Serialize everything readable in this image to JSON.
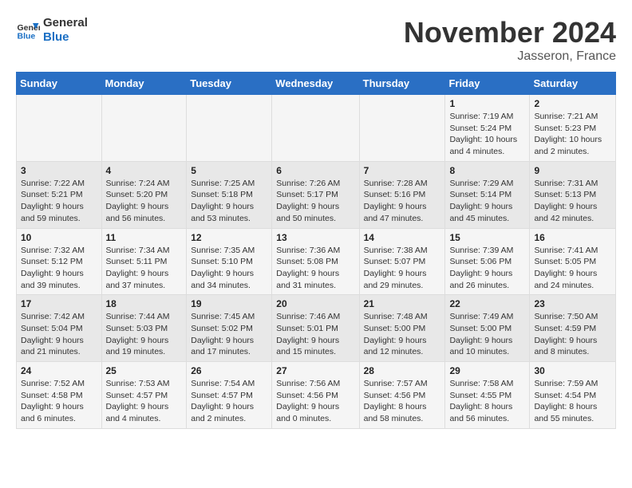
{
  "header": {
    "logo_line1": "General",
    "logo_line2": "Blue",
    "month": "November 2024",
    "location": "Jasseron, France"
  },
  "days_of_week": [
    "Sunday",
    "Monday",
    "Tuesday",
    "Wednesday",
    "Thursday",
    "Friday",
    "Saturday"
  ],
  "weeks": [
    [
      {
        "day": "",
        "info": ""
      },
      {
        "day": "",
        "info": ""
      },
      {
        "day": "",
        "info": ""
      },
      {
        "day": "",
        "info": ""
      },
      {
        "day": "",
        "info": ""
      },
      {
        "day": "1",
        "info": "Sunrise: 7:19 AM\nSunset: 5:24 PM\nDaylight: 10 hours and 4 minutes."
      },
      {
        "day": "2",
        "info": "Sunrise: 7:21 AM\nSunset: 5:23 PM\nDaylight: 10 hours and 2 minutes."
      }
    ],
    [
      {
        "day": "3",
        "info": "Sunrise: 7:22 AM\nSunset: 5:21 PM\nDaylight: 9 hours and 59 minutes."
      },
      {
        "day": "4",
        "info": "Sunrise: 7:24 AM\nSunset: 5:20 PM\nDaylight: 9 hours and 56 minutes."
      },
      {
        "day": "5",
        "info": "Sunrise: 7:25 AM\nSunset: 5:18 PM\nDaylight: 9 hours and 53 minutes."
      },
      {
        "day": "6",
        "info": "Sunrise: 7:26 AM\nSunset: 5:17 PM\nDaylight: 9 hours and 50 minutes."
      },
      {
        "day": "7",
        "info": "Sunrise: 7:28 AM\nSunset: 5:16 PM\nDaylight: 9 hours and 47 minutes."
      },
      {
        "day": "8",
        "info": "Sunrise: 7:29 AM\nSunset: 5:14 PM\nDaylight: 9 hours and 45 minutes."
      },
      {
        "day": "9",
        "info": "Sunrise: 7:31 AM\nSunset: 5:13 PM\nDaylight: 9 hours and 42 minutes."
      }
    ],
    [
      {
        "day": "10",
        "info": "Sunrise: 7:32 AM\nSunset: 5:12 PM\nDaylight: 9 hours and 39 minutes."
      },
      {
        "day": "11",
        "info": "Sunrise: 7:34 AM\nSunset: 5:11 PM\nDaylight: 9 hours and 37 minutes."
      },
      {
        "day": "12",
        "info": "Sunrise: 7:35 AM\nSunset: 5:10 PM\nDaylight: 9 hours and 34 minutes."
      },
      {
        "day": "13",
        "info": "Sunrise: 7:36 AM\nSunset: 5:08 PM\nDaylight: 9 hours and 31 minutes."
      },
      {
        "day": "14",
        "info": "Sunrise: 7:38 AM\nSunset: 5:07 PM\nDaylight: 9 hours and 29 minutes."
      },
      {
        "day": "15",
        "info": "Sunrise: 7:39 AM\nSunset: 5:06 PM\nDaylight: 9 hours and 26 minutes."
      },
      {
        "day": "16",
        "info": "Sunrise: 7:41 AM\nSunset: 5:05 PM\nDaylight: 9 hours and 24 minutes."
      }
    ],
    [
      {
        "day": "17",
        "info": "Sunrise: 7:42 AM\nSunset: 5:04 PM\nDaylight: 9 hours and 21 minutes."
      },
      {
        "day": "18",
        "info": "Sunrise: 7:44 AM\nSunset: 5:03 PM\nDaylight: 9 hours and 19 minutes."
      },
      {
        "day": "19",
        "info": "Sunrise: 7:45 AM\nSunset: 5:02 PM\nDaylight: 9 hours and 17 minutes."
      },
      {
        "day": "20",
        "info": "Sunrise: 7:46 AM\nSunset: 5:01 PM\nDaylight: 9 hours and 15 minutes."
      },
      {
        "day": "21",
        "info": "Sunrise: 7:48 AM\nSunset: 5:00 PM\nDaylight: 9 hours and 12 minutes."
      },
      {
        "day": "22",
        "info": "Sunrise: 7:49 AM\nSunset: 5:00 PM\nDaylight: 9 hours and 10 minutes."
      },
      {
        "day": "23",
        "info": "Sunrise: 7:50 AM\nSunset: 4:59 PM\nDaylight: 9 hours and 8 minutes."
      }
    ],
    [
      {
        "day": "24",
        "info": "Sunrise: 7:52 AM\nSunset: 4:58 PM\nDaylight: 9 hours and 6 minutes."
      },
      {
        "day": "25",
        "info": "Sunrise: 7:53 AM\nSunset: 4:57 PM\nDaylight: 9 hours and 4 minutes."
      },
      {
        "day": "26",
        "info": "Sunrise: 7:54 AM\nSunset: 4:57 PM\nDaylight: 9 hours and 2 minutes."
      },
      {
        "day": "27",
        "info": "Sunrise: 7:56 AM\nSunset: 4:56 PM\nDaylight: 9 hours and 0 minutes."
      },
      {
        "day": "28",
        "info": "Sunrise: 7:57 AM\nSunset: 4:56 PM\nDaylight: 8 hours and 58 minutes."
      },
      {
        "day": "29",
        "info": "Sunrise: 7:58 AM\nSunset: 4:55 PM\nDaylight: 8 hours and 56 minutes."
      },
      {
        "day": "30",
        "info": "Sunrise: 7:59 AM\nSunset: 4:54 PM\nDaylight: 8 hours and 55 minutes."
      }
    ]
  ]
}
